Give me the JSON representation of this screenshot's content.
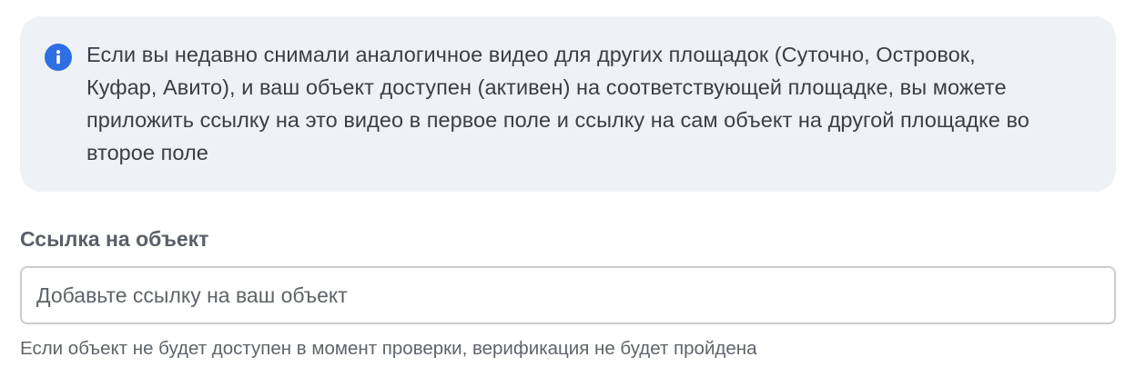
{
  "notice": {
    "icon": "info-icon",
    "icon_color": "#2f6fe4",
    "background_color": "#eef1f5",
    "lines": [
      "Если вы недавно снимали аналогичное видео для других площадок (Суточно, Островок,",
      "Куфар, Авито), и ваш объект доступен (активен) на соответствующей площадке, вы можете",
      "приложить ссылку на это видео в первое поле и ссылку на сам объект на другой площадке во",
      "второе поле"
    ]
  },
  "object_link": {
    "label": "Ссылка на объект",
    "value": "",
    "placeholder": "Добавьте ссылку на ваш объект",
    "hint": "Если объект не будет доступен в момент проверки, верификация не будет пройдена"
  }
}
